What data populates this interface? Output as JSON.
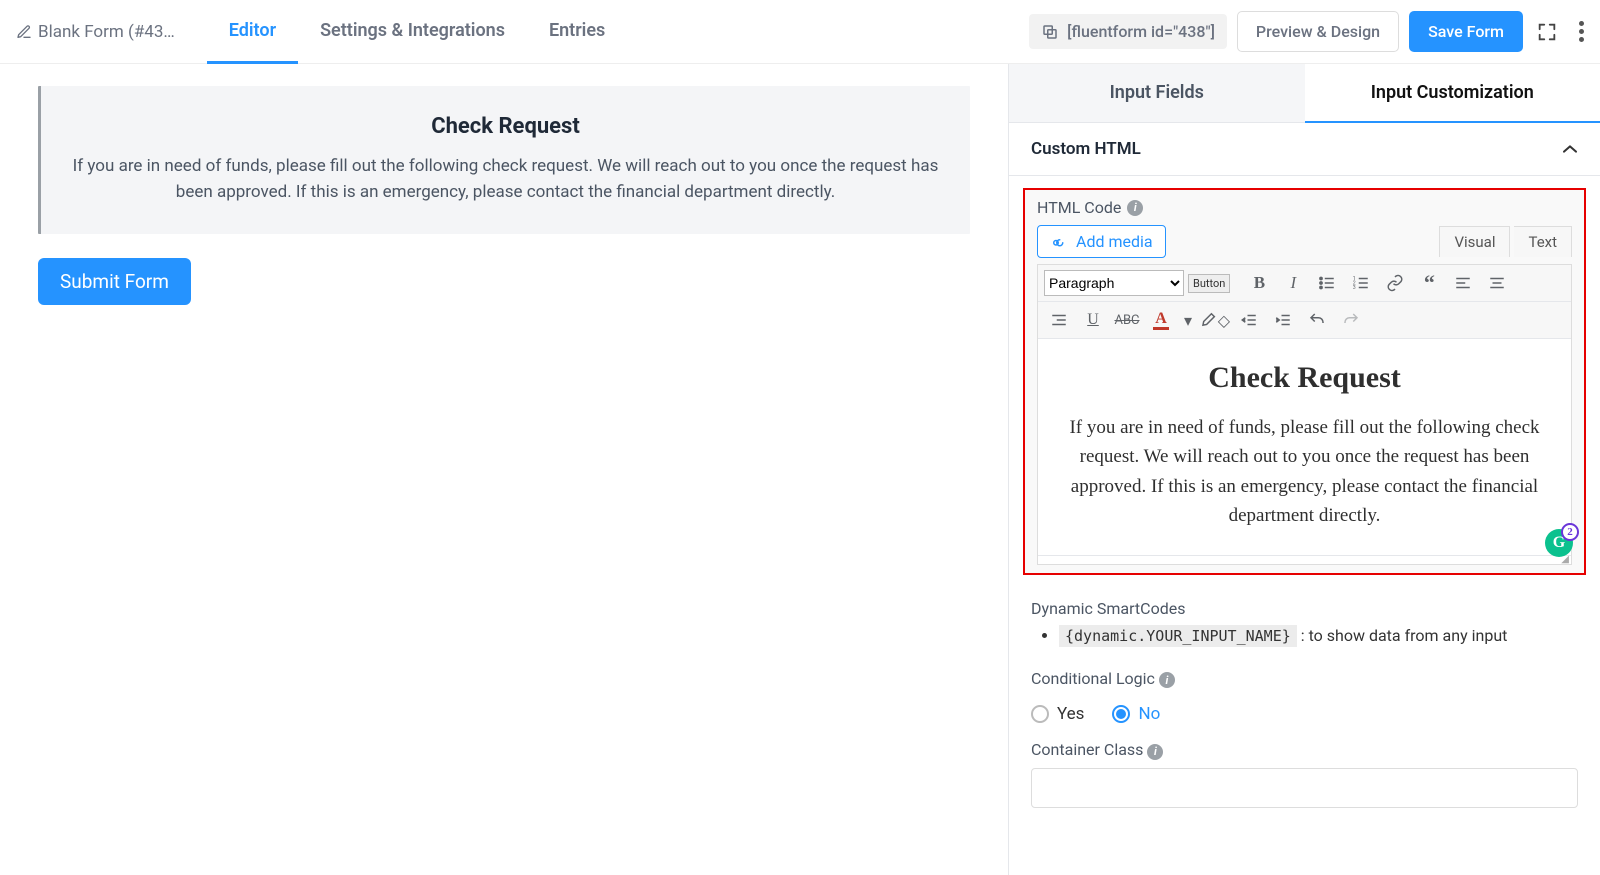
{
  "header": {
    "form_title": "Blank Form (#43…",
    "tabs": {
      "editor": "Editor",
      "settings": "Settings & Integrations",
      "entries": "Entries"
    },
    "shortcode": "[fluentform id=\"438\"]",
    "preview_btn": "Preview & Design",
    "save_btn": "Save Form"
  },
  "canvas": {
    "heading": "Check Request",
    "body": "If you are in need of funds, please fill out the following check request. We will reach out to you once the request has been approved. If this is an emergency, please contact the financial department directly.",
    "submit": "Submit Form"
  },
  "sidebar": {
    "tabs": {
      "fields": "Input Fields",
      "custom": "Input Customization"
    },
    "section": "Custom HTML",
    "html_code_label": "HTML Code",
    "add_media": "Add media",
    "tabs_small": {
      "visual": "Visual",
      "text": "Text"
    },
    "format_select": "Paragraph",
    "button_chip": "Button",
    "content_heading": "Check Request",
    "content_body": "If you are in need of funds, please fill out the following check request. We will reach out to you once the request has been approved. If this is an emergency, please contact the financial department directly.",
    "grammarly_badge": "2",
    "smartcodes_heading": "Dynamic SmartCodes",
    "smartcode_token": "{dynamic.YOUR_INPUT_NAME}",
    "smartcode_desc": " : to show data from any input",
    "conditional_label": "Conditional Logic",
    "radio_yes": "Yes",
    "radio_no": "No",
    "container_class_label": "Container Class"
  }
}
